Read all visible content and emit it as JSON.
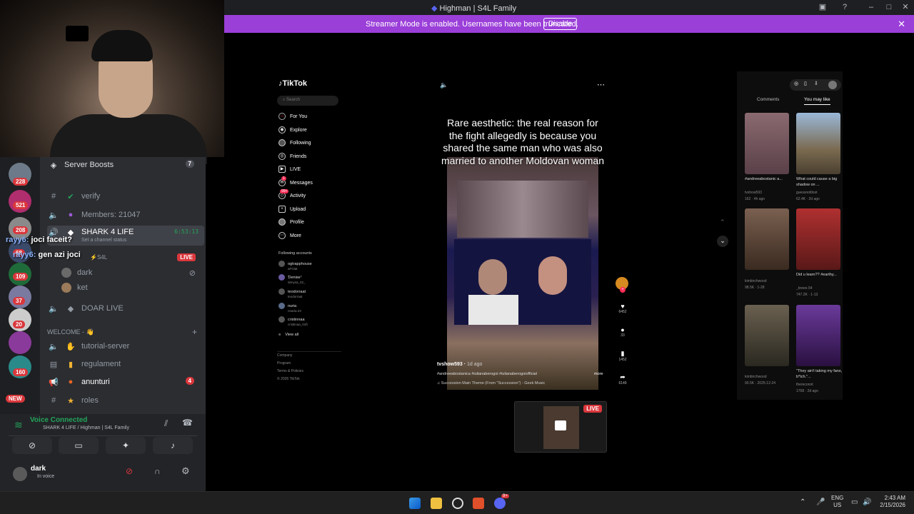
{
  "window": {
    "title": "Highman | S4L Family",
    "icons": [
      "discord-icon",
      "inbox-icon",
      "help-icon",
      "minimize-icon",
      "maximize-icon",
      "close-icon"
    ]
  },
  "banner": {
    "message": "Streamer Mode is enabled. Usernames have been truncated.",
    "button": "Disable",
    "close": "✕"
  },
  "discord": {
    "guild_badges": [
      "228",
      "521",
      "208",
      "68",
      "109",
      "37",
      "20",
      "160"
    ],
    "new_badge": "NEW",
    "server_boosts": {
      "label": "Server Boosts",
      "count": "7"
    },
    "channels": [
      {
        "label": "verify"
      },
      {
        "label": "Members: 21047"
      },
      {
        "label": "SHARK 4 LIFE",
        "time": "6:53:13",
        "status": "Set a channel status"
      },
      {
        "label": "⚡S4L",
        "live": "LIVE"
      },
      {
        "label": "dark"
      },
      {
        "label": "ket"
      },
      {
        "label": "DOAR LIVE"
      }
    ],
    "category": "WELCOME - 👋",
    "welcome_channels": [
      {
        "label": "tutorial-server"
      },
      {
        "label": "regulament"
      },
      {
        "label": "anunturi",
        "badge": "4"
      },
      {
        "label": "roles"
      }
    ],
    "voice": {
      "status": "Voice Connected",
      "channel": "SHARK 4 LIFE / Highman | S4L Family"
    },
    "user": {
      "name": "dark",
      "status": "In voice"
    }
  },
  "chat": [
    {
      "user": "rayy6:",
      "text": "joci faceit?"
    },
    {
      "user": "rayy6:",
      "text": "gen azi joci"
    }
  ],
  "tiktok": {
    "logo": "TikTok",
    "search_placeholder": "Search",
    "nav": [
      "For You",
      "Explore",
      "Following",
      "Friends",
      "LIVE",
      "Messages",
      "Activity",
      "Upload",
      "Profile",
      "More"
    ],
    "messages_badge": "1",
    "activity_badge": "99+",
    "following_title": "Following accounts",
    "accounts": [
      {
        "name": "ogtrapphouse",
        "handle": "aFGlat"
      },
      {
        "name": "Ɗenise⁷",
        "handle": "denysa_02_"
      },
      {
        "name": "teodorraat",
        "handle": "teodorraat"
      },
      {
        "name": "nuria",
        "handle": "nnaria.23"
      },
      {
        "name": "cristinnaa",
        "handle": "cristiinaa_01ft"
      }
    ],
    "view_all": "View all",
    "footer": [
      "Company",
      "Program",
      "Terms & Policies",
      "© 2026 TikTok"
    ],
    "video": {
      "caption": "Rare aesthetic: the real reason for the fight allegedly is because you shared the same man who was also married to another Moldovan woman",
      "author": "tvshow593",
      "age": "1d ago",
      "tags": "#andreeabostanica #iulianaberogoi #iulianaberogoiofficial",
      "more": "more",
      "music": "♫ Succession Main Theme (From \"Succession\") - Geek Music"
    },
    "actions": [
      {
        "icon": "heart-icon",
        "count": "6452"
      },
      {
        "icon": "comment-icon",
        "count": "33"
      },
      {
        "icon": "bookmark-icon",
        "count": "1452"
      },
      {
        "icon": "share-icon",
        "count": "6149"
      }
    ],
    "tabs": [
      "Comments",
      "You may like"
    ],
    "suggestions": [
      {
        "caption": "#andreeabostanic a...",
        "author": "tvshow593",
        "stats": "162 · 4h ago",
        "color": "#6b4a52"
      },
      {
        "caption": "What could cause a big shadow on ...",
        "author": "guessnottlost",
        "stats": "62.4K · 2d ago",
        "color": "#6d8aa0"
      },
      {
        "caption": "",
        "author": "kimbirchwood",
        "stats": "98.5K · 1-28",
        "color": "#5a4a40"
      },
      {
        "caption": "Did u learn?? #earthy...",
        "author": "_breee.54",
        "stats": "747.2K · 1-13",
        "color": "#8a2a2a"
      },
      {
        "caption": "",
        "author": "kimbirchwood",
        "stats": "90.5K · 2025-12-24",
        "color": "#4a4a38"
      },
      {
        "caption": "\"They ain't taking my fans, b*tch.\"...",
        "author": "thereconnt",
        "stats": "1768 · 2d ago",
        "color": "#5a2a7a"
      }
    ],
    "pip_live": "LIVE"
  },
  "taskbar": {
    "lang": "ENG",
    "region": "US",
    "time": "2:43 AM",
    "date": "2/15/2026",
    "discord_badge": "9+"
  }
}
